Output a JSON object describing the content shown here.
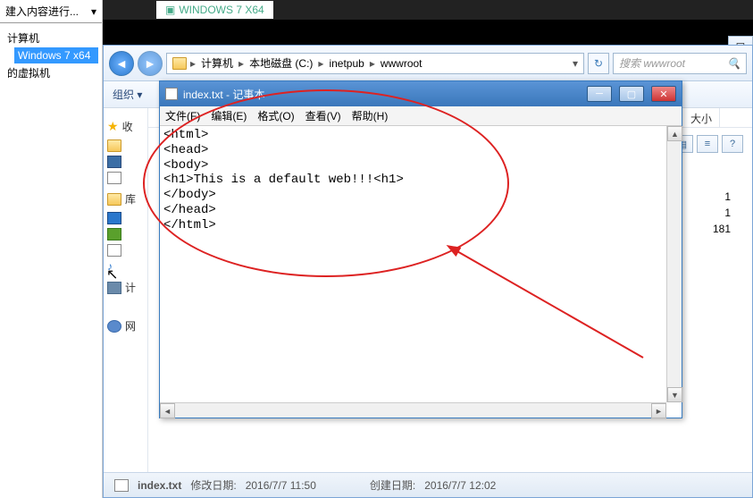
{
  "vm": {
    "dropdown": "建入内容进行...",
    "root": "计算机",
    "sel": "Windows 7 x64",
    "other": "的虚拟机"
  },
  "tab_label": "WINDOWS 7 X64",
  "breadcrumb": {
    "root": "计算机",
    "disk": "本地磁盘 (C:)",
    "d1": "inetpub",
    "d2": "wwwroot"
  },
  "search_placeholder": "搜索 wwwroot",
  "toolbar": {
    "organize": "组织"
  },
  "sidebar2": {
    "fav": "收",
    "lib": "库",
    "pc": "计",
    "net": "网"
  },
  "cols": {
    "size": "大小"
  },
  "sizes": [
    "1",
    "1",
    "181"
  ],
  "status": {
    "file": "index.txt",
    "mod_label": "修改日期:",
    "mod_val": "2016/7/7 11:50",
    "create_label": "创建日期:",
    "create_val": "2016/7/7 12:02"
  },
  "notepad": {
    "title": "index.txt - 记事本",
    "menu": {
      "file": "文件(F)",
      "edit": "编辑(E)",
      "format": "格式(O)",
      "view": "查看(V)",
      "help": "帮助(H)"
    },
    "lines": [
      "<html>",
      "<head>",
      "<body>",
      "<h1>This is a default web!!!<h1>",
      "</body>",
      "</head>",
      "</html>"
    ]
  }
}
